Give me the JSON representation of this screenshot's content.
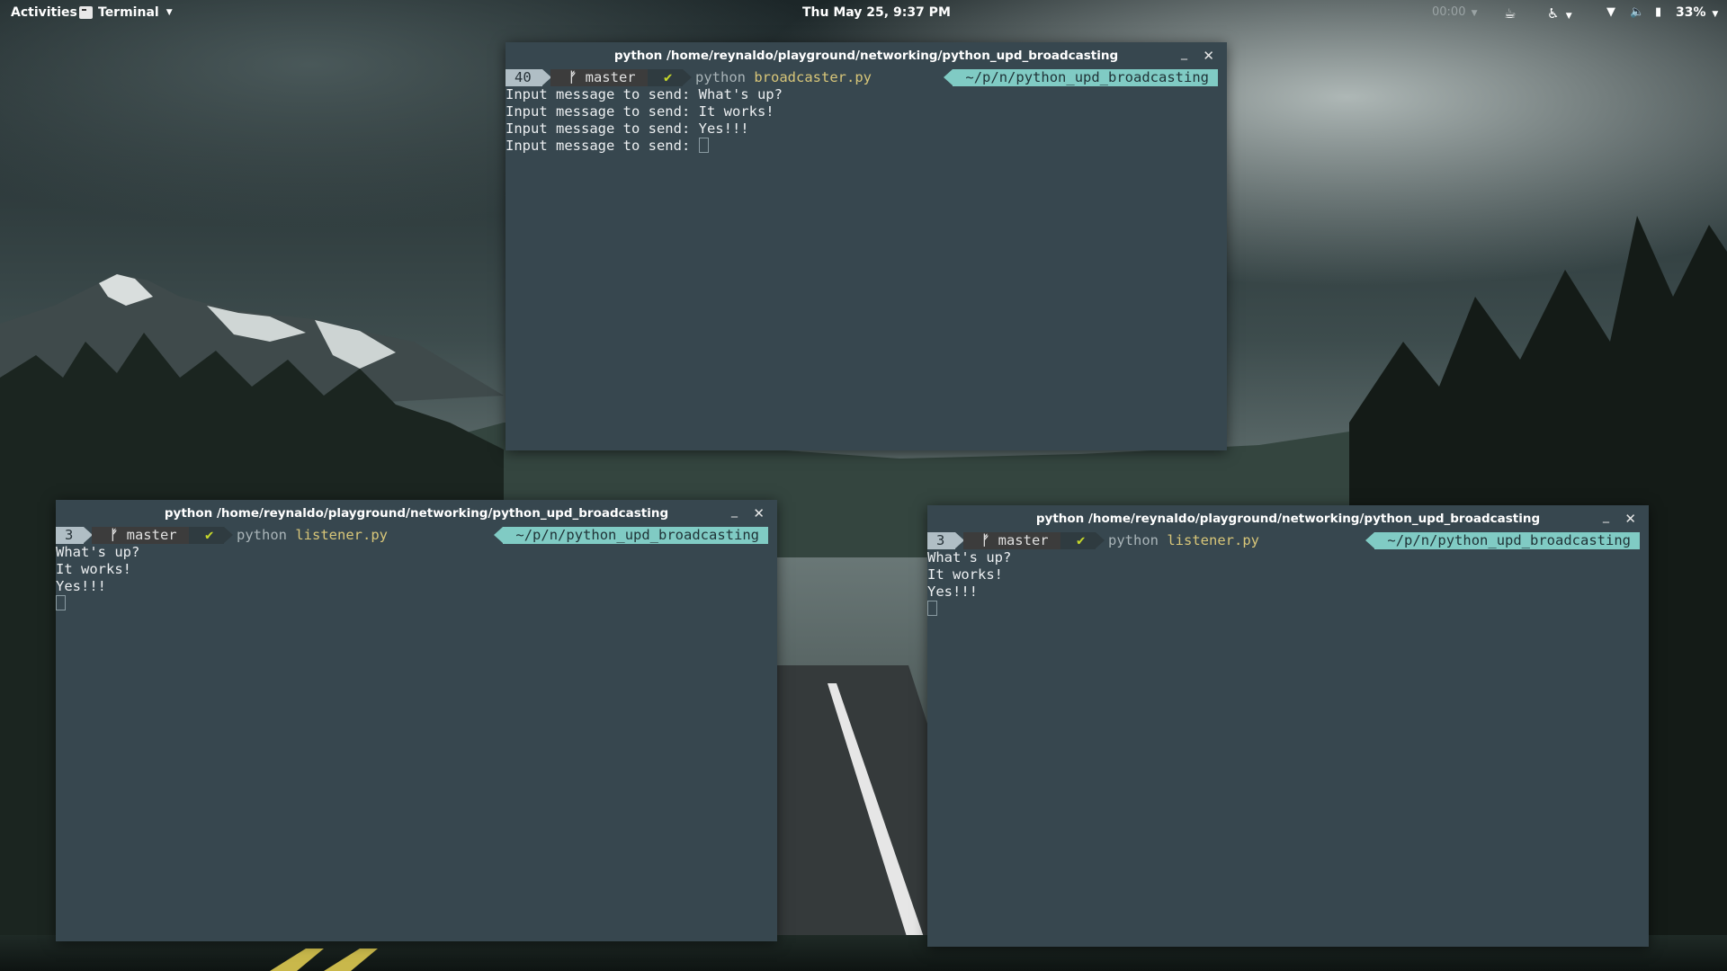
{
  "topbar": {
    "activities": "Activities",
    "app_name": "Terminal",
    "clock": "Thu May 25,  9:37 PM",
    "timer": "00:00",
    "battery_percent": "33%"
  },
  "icons": {
    "app": "terminal-icon",
    "coffee": "coffee-icon",
    "accessibility": "accessibility-icon",
    "wifi": "wifi-icon",
    "volume": "volume-icon",
    "battery": "battery-icon"
  },
  "windows": {
    "broadcaster": {
      "title": "python  /home/reynaldo/playground/networking/python_upd_broadcasting",
      "prompt": {
        "number": "40",
        "branch": "master",
        "check": "✔",
        "command": "python",
        "file": "broadcaster.py",
        "path": "~/p/n/python_upd_broadcasting"
      },
      "lines": [
        "Input message to send: What's up?",
        "Input message to send: It works!",
        "Input message to send: Yes!!!",
        "Input message to send: "
      ]
    },
    "listener_left": {
      "title": "python  /home/reynaldo/playground/networking/python_upd_broadcasting",
      "prompt": {
        "number": "3",
        "branch": "master",
        "check": "✔",
        "command": "python",
        "file": "listener.py",
        "path": "~/p/n/python_upd_broadcasting"
      },
      "lines": [
        "What's up?",
        "It works!",
        "Yes!!!"
      ]
    },
    "listener_right": {
      "title": "python  /home/reynaldo/playground/networking/python_upd_broadcasting",
      "prompt": {
        "number": "3",
        "branch": "master",
        "check": "✔",
        "command": "python",
        "file": "listener.py",
        "path": "~/p/n/python_upd_broadcasting"
      },
      "lines": [
        "What's up?",
        "It works!",
        "Yes!!!"
      ]
    }
  },
  "colors": {
    "terminal_bg": "#37474f",
    "prompt_number_bg": "#b0bec5",
    "prompt_path_bg": "#80cbc4",
    "filename": "#d8c679",
    "check": "#c6d72b"
  }
}
